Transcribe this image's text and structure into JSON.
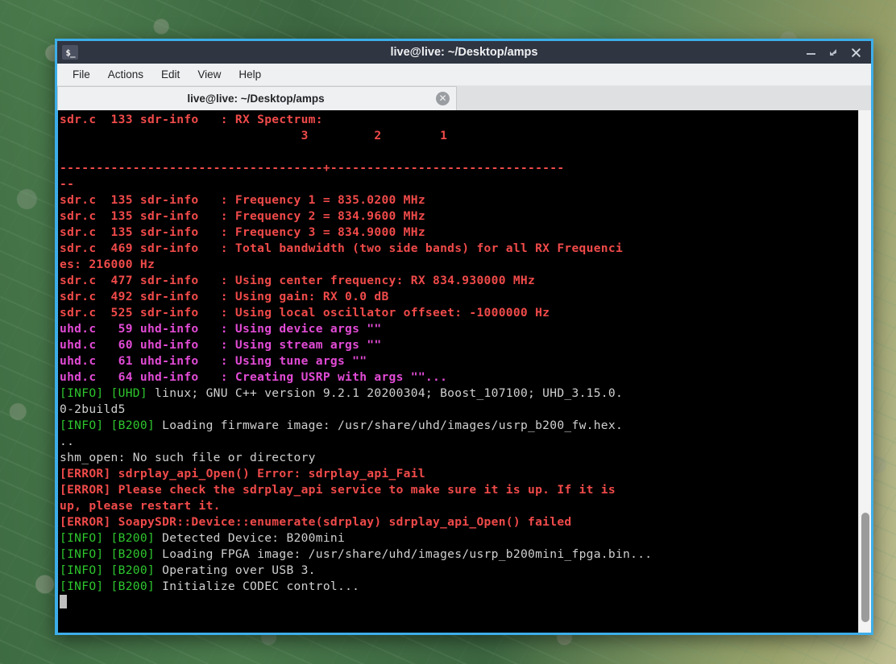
{
  "window": {
    "title": "live@live: ~/Desktop/amps",
    "icon": "terminal-icon",
    "controls": {
      "minimize": "minimize-icon",
      "maximize": "maximize-icon",
      "close": "close-icon"
    },
    "accent_color": "#3daee9",
    "titlebar_color": "#2f3541"
  },
  "menubar": {
    "items": [
      {
        "label": "File"
      },
      {
        "label": "Actions"
      },
      {
        "label": "Edit"
      },
      {
        "label": "View"
      },
      {
        "label": "Help"
      }
    ]
  },
  "tabs": [
    {
      "label": "live@live: ~/Desktop/amps",
      "active": true,
      "close": "✕"
    }
  ],
  "terminal": {
    "background": "#000000",
    "colors": {
      "red": "#f04a4a",
      "magenta": "#e24bd6",
      "green": "#2ec72e",
      "white": "#d0d0d0"
    },
    "lines": [
      {
        "segments": [
          {
            "text": "sdr.c  133 sdr-info   : RX Spectrum:",
            "color": "red"
          }
        ]
      },
      {
        "segments": [
          {
            "text": "                                 3         2        1",
            "color": "red"
          }
        ]
      },
      {
        "segments": [
          {
            "text": "",
            "color": "red"
          }
        ]
      },
      {
        "segments": [
          {
            "text": "------------------------------------+--------------------------------",
            "color": "red"
          }
        ]
      },
      {
        "segments": [
          {
            "text": "--",
            "color": "red"
          }
        ]
      },
      {
        "segments": [
          {
            "text": "sdr.c  135 sdr-info   : Frequency 1 = 835.0200 MHz",
            "color": "red"
          }
        ]
      },
      {
        "segments": [
          {
            "text": "sdr.c  135 sdr-info   : Frequency 2 = 834.9600 MHz",
            "color": "red"
          }
        ]
      },
      {
        "segments": [
          {
            "text": "sdr.c  135 sdr-info   : Frequency 3 = 834.9000 MHz",
            "color": "red"
          }
        ]
      },
      {
        "segments": [
          {
            "text": "sdr.c  469 sdr-info   : Total bandwidth (two side bands) for all RX Frequenci",
            "color": "red"
          }
        ]
      },
      {
        "segments": [
          {
            "text": "es: 216000 Hz",
            "color": "red"
          }
        ]
      },
      {
        "segments": [
          {
            "text": "sdr.c  477 sdr-info   : Using center frequency: RX 834.930000 MHz",
            "color": "red"
          }
        ]
      },
      {
        "segments": [
          {
            "text": "sdr.c  492 sdr-info   : Using gain: RX 0.0 dB",
            "color": "red"
          }
        ]
      },
      {
        "segments": [
          {
            "text": "sdr.c  525 sdr-info   : Using local oscillator offseet: -1000000 Hz",
            "color": "red"
          }
        ]
      },
      {
        "segments": [
          {
            "text": "uhd.c   59 uhd-info   : Using device args \"\"",
            "color": "magenta"
          }
        ]
      },
      {
        "segments": [
          {
            "text": "uhd.c   60 uhd-info   : Using stream args \"\"",
            "color": "magenta"
          }
        ]
      },
      {
        "segments": [
          {
            "text": "uhd.c   61 uhd-info   : Using tune args \"\"",
            "color": "magenta"
          }
        ]
      },
      {
        "segments": [
          {
            "text": "uhd.c   64 uhd-info   : Creating USRP with args \"\"...",
            "color": "magenta"
          }
        ]
      },
      {
        "segments": [
          {
            "text": "[INFO] [UHD]",
            "color": "green"
          },
          {
            "text": " linux; GNU C++ version 9.2.1 20200304; Boost_107100; UHD_3.15.0.",
            "color": "white"
          }
        ]
      },
      {
        "segments": [
          {
            "text": "0-2build5",
            "color": "white"
          }
        ]
      },
      {
        "segments": [
          {
            "text": "[INFO] [B200]",
            "color": "green"
          },
          {
            "text": " Loading firmware image: /usr/share/uhd/images/usrp_b200_fw.hex.",
            "color": "white"
          }
        ]
      },
      {
        "segments": [
          {
            "text": "..",
            "color": "white"
          }
        ]
      },
      {
        "segments": [
          {
            "text": "shm_open: No such file or directory",
            "color": "white"
          }
        ]
      },
      {
        "segments": [
          {
            "text": "[ERROR] sdrplay_api_Open() Error: sdrplay_api_Fail",
            "color": "red"
          }
        ]
      },
      {
        "segments": [
          {
            "text": "[ERROR] Please check the sdrplay_api service to make sure it is up. If it is",
            "color": "red"
          }
        ]
      },
      {
        "segments": [
          {
            "text": "up, please restart it.",
            "color": "red"
          }
        ]
      },
      {
        "segments": [
          {
            "text": "[ERROR] SoapySDR::Device::enumerate(sdrplay) sdrplay_api_Open() failed",
            "color": "red"
          }
        ]
      },
      {
        "segments": [
          {
            "text": "[INFO] [B200]",
            "color": "green"
          },
          {
            "text": " Detected Device: B200mini",
            "color": "white"
          }
        ]
      },
      {
        "segments": [
          {
            "text": "[INFO] [B200]",
            "color": "green"
          },
          {
            "text": " Loading FPGA image: /usr/share/uhd/images/usrp_b200mini_fpga.bin...",
            "color": "white"
          }
        ]
      },
      {
        "segments": [
          {
            "text": "[INFO] [B200]",
            "color": "green"
          },
          {
            "text": " Operating over USB 3.",
            "color": "white"
          }
        ]
      },
      {
        "segments": [
          {
            "text": "[INFO] [B200]",
            "color": "green"
          },
          {
            "text": " Initialize CODEC control...",
            "color": "white"
          }
        ]
      },
      {
        "segments": [
          {
            "text": "",
            "color": "white"
          }
        ],
        "cursor": true
      }
    ]
  },
  "scrollbar": {
    "thumb_top_percent": 77,
    "thumb_height_percent": 21
  }
}
